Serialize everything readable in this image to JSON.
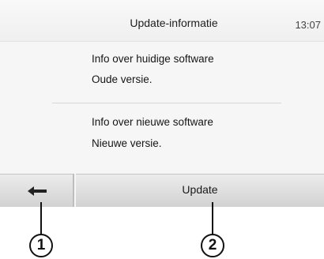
{
  "header": {
    "title": "Update-informatie",
    "time": "13:07"
  },
  "current_software": {
    "label": "Info over huidige software",
    "version": "Oude versie."
  },
  "new_software": {
    "label": "Info over nieuwe software",
    "version": "Nieuwe versie."
  },
  "bottom_bar": {
    "back_icon": "left-arrow-icon",
    "update_label": "Update"
  },
  "callouts": [
    "1",
    "2"
  ]
}
